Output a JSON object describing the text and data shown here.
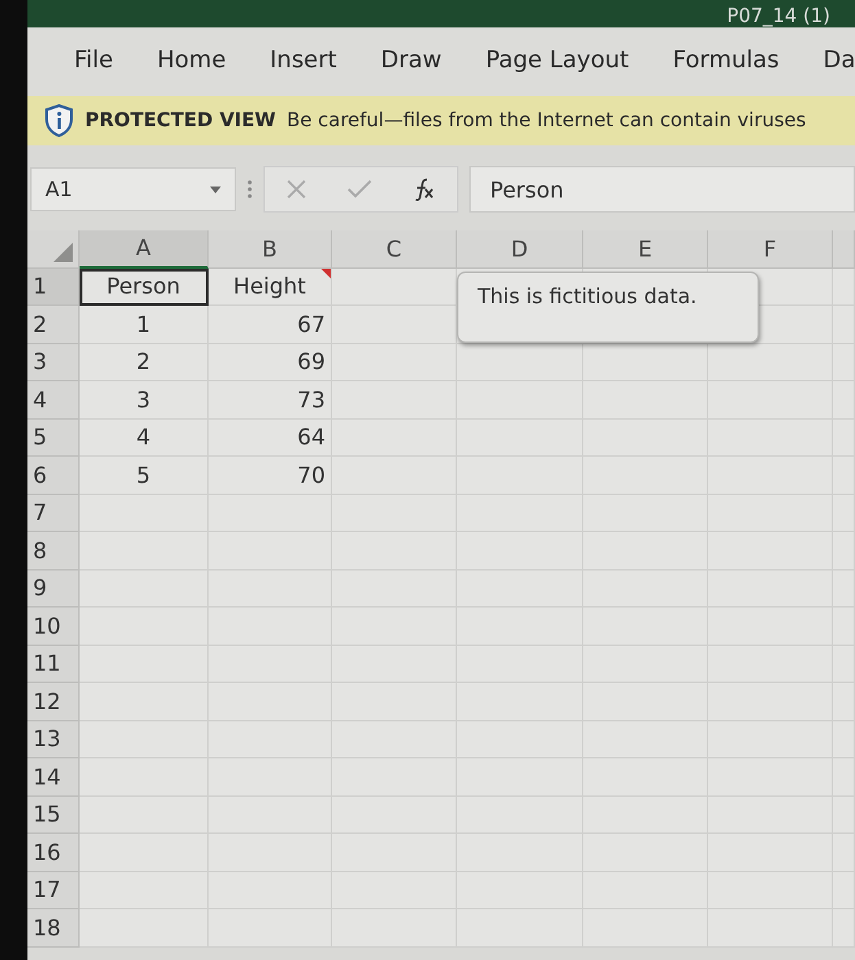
{
  "title_bar": {
    "file_name": "P07_14 (1)"
  },
  "ribbon_tabs": [
    {
      "label": "File",
      "selected": false
    },
    {
      "label": "Home",
      "selected": false
    },
    {
      "label": "Insert",
      "selected": false
    },
    {
      "label": "Draw",
      "selected": false
    },
    {
      "label": "Page Layout",
      "selected": false
    },
    {
      "label": "Formulas",
      "selected": false
    },
    {
      "label": "Da",
      "selected": false
    }
  ],
  "protected_view": {
    "title": "PROTECTED VIEW",
    "message": "Be careful—files from the Internet can contain viruses"
  },
  "formula_bar": {
    "name_box": "A1",
    "formula": "Person"
  },
  "columns": [
    "A",
    "B",
    "C",
    "D",
    "E",
    "F"
  ],
  "rows": [
    {
      "number": "1",
      "cells": [
        {
          "text": "Person",
          "kind": "centered",
          "selected": true,
          "comment": false
        },
        {
          "text": "Height",
          "kind": "centered",
          "selected": false,
          "comment": true
        }
      ]
    },
    {
      "number": "2",
      "cells": [
        {
          "text": "1",
          "kind": "centered",
          "selected": false,
          "comment": false
        },
        {
          "text": "67",
          "kind": "number",
          "selected": false,
          "comment": false
        }
      ]
    },
    {
      "number": "3",
      "cells": [
        {
          "text": "2",
          "kind": "centered",
          "selected": false,
          "comment": false
        },
        {
          "text": "69",
          "kind": "number",
          "selected": false,
          "comment": false
        }
      ]
    },
    {
      "number": "4",
      "cells": [
        {
          "text": "3",
          "kind": "centered",
          "selected": false,
          "comment": false
        },
        {
          "text": "73",
          "kind": "number",
          "selected": false,
          "comment": false
        }
      ]
    },
    {
      "number": "5",
      "cells": [
        {
          "text": "4",
          "kind": "centered",
          "selected": false,
          "comment": false
        },
        {
          "text": "64",
          "kind": "number",
          "selected": false,
          "comment": false
        }
      ]
    },
    {
      "number": "6",
      "cells": [
        {
          "text": "5",
          "kind": "centered",
          "selected": false,
          "comment": false
        },
        {
          "text": "70",
          "kind": "number",
          "selected": false,
          "comment": false
        }
      ]
    },
    {
      "number": "7",
      "cells": []
    },
    {
      "number": "8",
      "cells": []
    },
    {
      "number": "9",
      "cells": []
    },
    {
      "number": "10",
      "cells": []
    },
    {
      "number": "11",
      "cells": []
    },
    {
      "number": "12",
      "cells": []
    },
    {
      "number": "13",
      "cells": []
    },
    {
      "number": "14",
      "cells": []
    },
    {
      "number": "15",
      "cells": []
    },
    {
      "number": "16",
      "cells": []
    },
    {
      "number": "17",
      "cells": []
    },
    {
      "number": "18",
      "cells": []
    }
  ],
  "comment": {
    "text": "This is fictitious data."
  }
}
